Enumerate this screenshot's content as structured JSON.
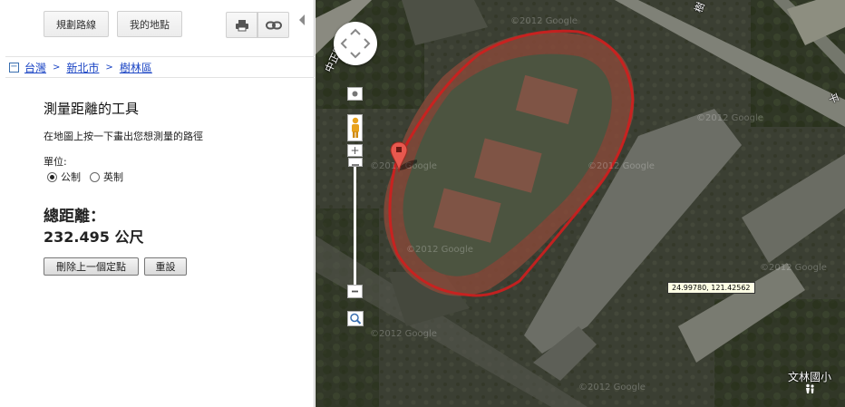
{
  "toolbar": {
    "directions_label": "規劃路線",
    "mymaps_label": "我的地點",
    "print_icon": "printer-icon",
    "link_icon": "link-icon"
  },
  "breadcrumb": {
    "toggle": "−",
    "items": [
      "台灣",
      "新北市",
      "樹林區"
    ],
    "separator": ">"
  },
  "tool": {
    "title": "測量距離的工具",
    "instruction": "在地圖上按一下畫出您想測量的路徑",
    "unit_label": "單位:",
    "unit_metric": "公制",
    "unit_imperial": "英制",
    "selected_unit": "公制",
    "total_label": "總距離：",
    "total_value": "232.495 公尺",
    "delete_last_label": "刪除上一個定點",
    "reset_label": "重設"
  },
  "map": {
    "coordinates": "24.99780, 121.42562",
    "place_label": "文林國小",
    "place_icon": "school-icon",
    "watermark": "©2012 Google",
    "road_labels": [
      "中正路",
      "樹",
      "平"
    ],
    "path_color": "#d01e1e",
    "marker_color": "#e8584e"
  }
}
